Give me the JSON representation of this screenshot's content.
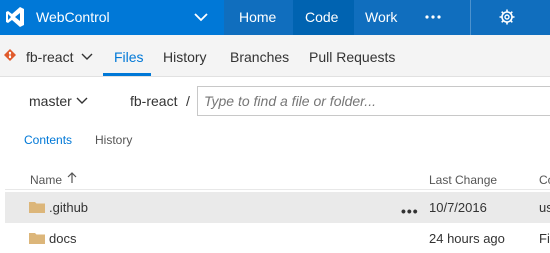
{
  "topbar": {
    "project": "WebControl",
    "nav": [
      {
        "label": "Home"
      },
      {
        "label": "Code"
      },
      {
        "label": "Work"
      }
    ],
    "more_icon": "ellipsis-icon",
    "settings_icon": "gear-icon"
  },
  "subnav": {
    "repo": "fb-react",
    "tabs": [
      {
        "label": "Files"
      },
      {
        "label": "History"
      },
      {
        "label": "Branches"
      },
      {
        "label": "Pull Requests"
      }
    ]
  },
  "pathbar": {
    "branch": "master",
    "repo_path": "fb-react",
    "separator": "/",
    "placeholder": "Type to find a file or folder..."
  },
  "content_tabs": [
    {
      "label": "Contents"
    },
    {
      "label": "History"
    }
  ],
  "table": {
    "headers": {
      "name": "Name",
      "last_change": "Last Change",
      "commit": "Co"
    },
    "rows": [
      {
        "name": ".github",
        "last_change": "10/7/2016",
        "commit": "us",
        "more": "•••"
      },
      {
        "name": "docs",
        "last_change": "24 hours ago",
        "commit": "Fi"
      }
    ]
  },
  "colors": {
    "accent": "#0078d7",
    "topbar": "#0078d7",
    "folder": "#dcb67a",
    "selected_row": "#eaeaea"
  }
}
